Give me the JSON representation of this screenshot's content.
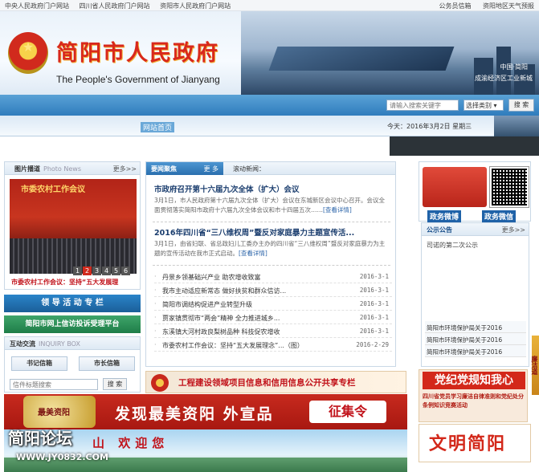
{
  "topbar": {
    "left_links": [
      "中央人民政府门户网站",
      "四川省人民政府门户网站",
      "资阳市人民政府门户网站"
    ],
    "right_links": [
      "公务员信箱",
      "资阳地区天气预报"
    ]
  },
  "header": {
    "title_cn": "简阳市人民政府",
    "title_en": "The People's Government of Jianyang",
    "banner_caption_1": "中国·简阳",
    "banner_caption_2": "成渝经济区工业新城"
  },
  "search": {
    "placeholder": "请输入搜索关键字",
    "select_label": "选择类别",
    "button_label": "搜 索"
  },
  "nav": {
    "home_label": "网站首页",
    "date_text": "今天：2016年3月2日  星期三"
  },
  "photo_news": {
    "title": "图片播道",
    "title_en": "Photo News",
    "more_label": "更多>>",
    "image_text": "市委农村工作会议",
    "pager": [
      "1",
      "2",
      "3",
      "4",
      "5",
      "6"
    ],
    "active_page": 2,
    "caption": "市委农村工作会议：坚持“五大发展理"
  },
  "left_banners": {
    "leadership": "领 导 活 动 专 栏",
    "petition": "简阳市网上信访投诉受理平台"
  },
  "interaction": {
    "title": "互动交流",
    "title_en": "INQUIRY BOX",
    "secretary_mailbox": "书记信箱",
    "mayor_mailbox": "市长信箱",
    "search_placeholder": "信件标题搜索",
    "search_button": "搜 索"
  },
  "news": {
    "tab_label": "要闻聚焦",
    "tab_more": "更 多",
    "scroll_label": "滚动新闻：",
    "featured": [
      {
        "headline": "市政府召开第十六届九次全体（扩大）会议",
        "summary": "3月1日，市人民政府第十六届九次全体（扩大）会议在东城新区会议中心召开。会议全面贯彻落实简阳市政府十六届九次全体会议和市十四届五次……",
        "more": "[查看详情]"
      },
      {
        "headline": "2016年四川省“三八维权周”暨反对家庭暴力主题宣传活...",
        "summary": "3月1日，由省妇联、省总政妇儿工委办主办的四川省“三八维权周”暨反对家庭暴力为主题的宣传活动在我市正式启动。",
        "more": "[查看详情]"
      }
    ],
    "items": [
      {
        "title": "丹景乡领基础兴产业  助农增收致富",
        "date": "2016-3-1"
      },
      {
        "title": "我市主动适应新常态  做好扶贫和群众信访...",
        "date": "2016-3-1"
      },
      {
        "title": "简阳市调结构促进产业转型升级",
        "date": "2016-3-1"
      },
      {
        "title": "贾家镇贯彻市“两会”精神  全力推进城乡...",
        "date": "2016-3-1"
      },
      {
        "title": "东溪镇大河村政良梨树品种  科技促农增收",
        "date": "2016-3-1"
      },
      {
        "title": "市委农村工作会议：坚持“五大发展理念”...（图）",
        "date": "2016-2-29"
      }
    ]
  },
  "credit_banner": {
    "text": "工程建设领域项目信息和信用信息公开共享专栏"
  },
  "promo": {
    "logo_text": "最美资阳",
    "slogan": "发现最美资阳 外宣品",
    "stamp": "征集令"
  },
  "welcome": {
    "text": "山  欢迎您"
  },
  "watermark": {
    "text": "简阳论坛",
    "url": "WWW.JY0832.COM"
  },
  "social": {
    "weibo_label": "政务微博",
    "weixin_label": "政务微信"
  },
  "notice": {
    "title": "公示公告",
    "more_label": "更多>>",
    "text": "司诺的第二次公示",
    "links": [
      "简阳市环境保护局关于2016",
      "简阳市环境保护局关于2016",
      "简阳市环境保护局关于2016"
    ]
  },
  "party_banner": {
    "title": "党纪党规知我心",
    "subtitle": "四川省党员学习廉洁自律准则和党纪处分条例知识竞赛活动"
  },
  "civil_banner": {
    "text": "文明简阳"
  },
  "side_float": {
    "text": "廉洁道"
  }
}
